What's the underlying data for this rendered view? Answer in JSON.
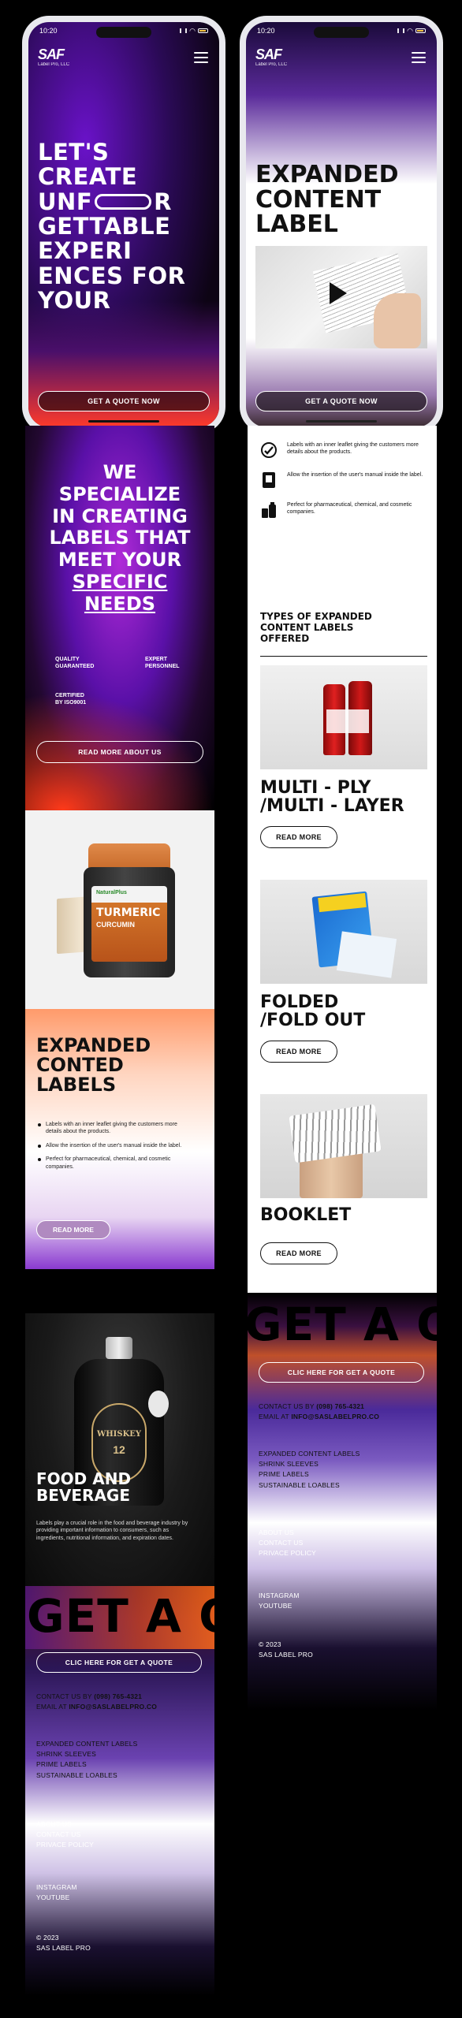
{
  "status": {
    "time": "10:20"
  },
  "brand": {
    "mark": "SAF",
    "name": "Label Pro, LLC"
  },
  "hero": {
    "lines": [
      "LET'S",
      "CREATE",
      "UNF",
      "R",
      "GETTABLE",
      "EXPERI",
      "ENCES FOR",
      "YOUR"
    ],
    "cta": "GET A QUOTE NOW"
  },
  "specialize": {
    "lines": [
      "WE",
      "SPECIALIZE",
      "IN CREATING",
      "LABELS THAT",
      "MEET YOUR"
    ],
    "underlined": [
      "SPECIFIC",
      "NEEDS"
    ],
    "stats": [
      {
        "line1": "QUALITY",
        "line2": "GUARANTEED"
      },
      {
        "line1": "EXPERT",
        "line2": "PERSONNEL"
      },
      {
        "line1": "CERTIFIED",
        "line2": "BY ISO9001"
      }
    ],
    "cta": "READ MORE ABOUT US"
  },
  "product_card": {
    "jar_brand": "NaturalPlus",
    "jar_title": "TURMERIC",
    "jar_sub": "CURCUMIN",
    "title_lines": [
      "EXPANDED",
      "CONTED",
      "LABELS"
    ],
    "bullets": [
      "Labels with an inner leaflet giving the customers more details about the products.",
      "Allow the insertion of the user's manual inside the label.",
      "Perfect for pharmaceutical, chemical, and cosmetic companies."
    ],
    "cta": "READ MORE"
  },
  "food_card": {
    "bottle_text": "WHISKEY",
    "bottle_num": "12",
    "title_lines": [
      "FOOD AND",
      "BEVERAGE"
    ],
    "body": "Labels play a crucial role in the food and beverage industry by providing important information to consumers, such as ingredients, nutritional information, and expiration dates."
  },
  "footer": {
    "big": "GET A Q",
    "cta": "CLIC HERE FOR GET A QUOTE",
    "contact_prefix": "CONTACT US BY",
    "phone": "(098) 765-4321",
    "email_prefix": "EMAIL AT",
    "email": "INFO@SASLABELPRO.CO",
    "products": [
      "EXPANDED CONTENT LABELS",
      "SHRINK SLEEVES",
      "PRIME LABELS",
      "SUSTAINABLE LOABLES"
    ],
    "links": [
      "ABOUT US",
      "CONTACT US",
      "PRIVACE POLICY"
    ],
    "social": [
      "INSTAGRAM",
      "YOUTUBE"
    ],
    "year": "© 2023",
    "company": "SAS LABEL PRO"
  },
  "right": {
    "hero_lines": [
      "EXPANDED",
      "CONTENT",
      "LABEL"
    ],
    "cta": "GET A QUOTE NOW",
    "features": [
      "Labels with an inner leaflet giving the customers more details about the products.",
      "Allow the insertion of the user's manual inside the label.",
      "Perfect for pharmaceutical, chemical, and cosmetic companies."
    ],
    "types_title_lines": [
      "TYPES OF EXPANDED",
      "CONTENT LABELS",
      "OFFERED"
    ],
    "types": [
      {
        "title_lines": [
          "MULTI - PLY",
          "/MULTI - LAYER"
        ],
        "cta": "READ MORE"
      },
      {
        "title_lines": [
          "FOLDED",
          "/FOLD OUT"
        ],
        "cta": "READ MORE"
      },
      {
        "title_lines": [
          "BOOKLET"
        ],
        "cta": "READ MORE"
      }
    ]
  },
  "colors": {
    "purple": "#6a12c9",
    "orange": "#ff4a1a",
    "dark": "#111111"
  }
}
